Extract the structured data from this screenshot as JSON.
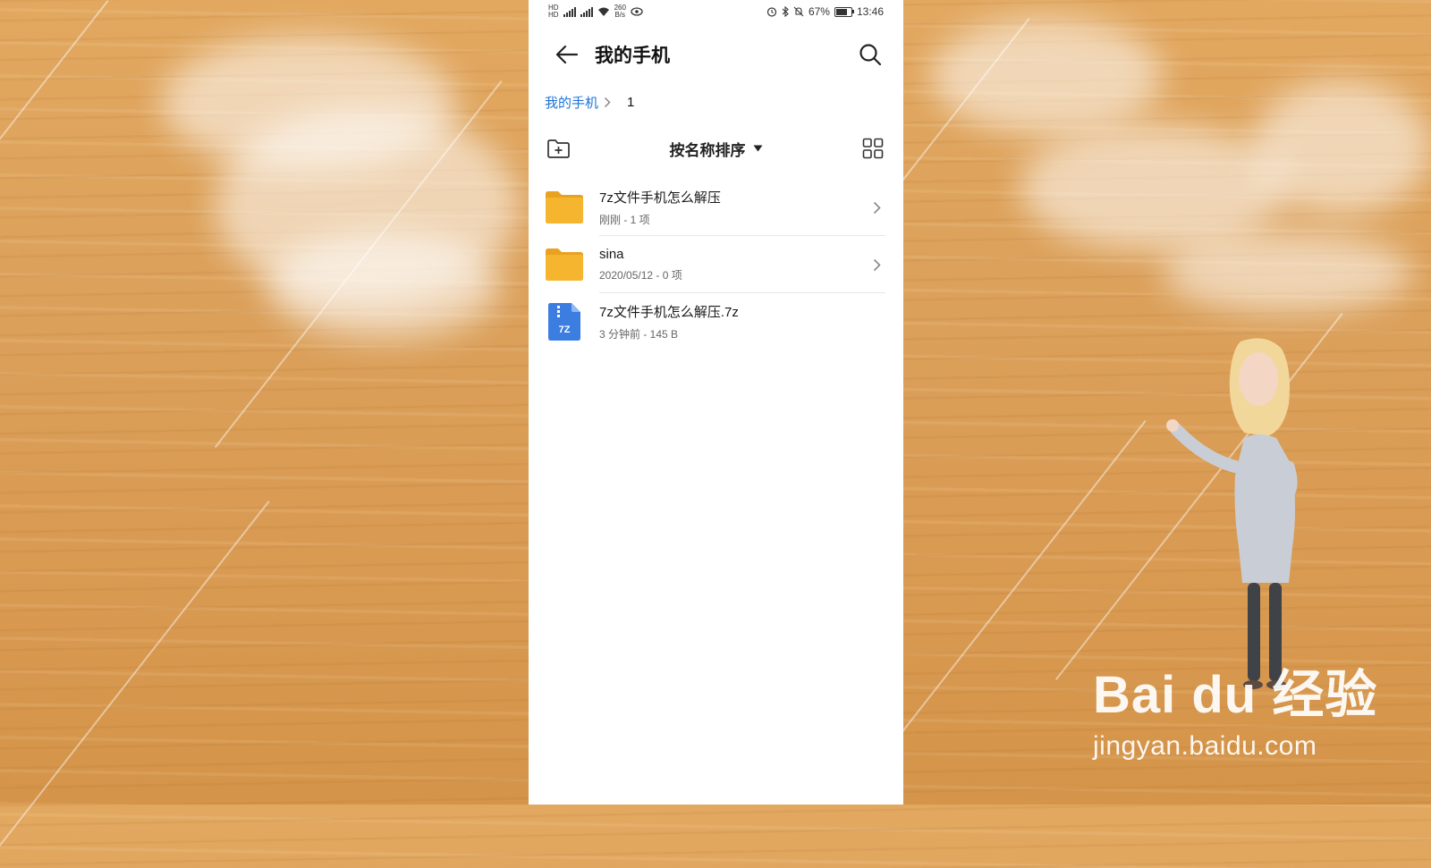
{
  "statusbar": {
    "network_speed": "260",
    "network_unit": "B/s",
    "battery": "67%",
    "time": "13:46"
  },
  "header": {
    "title": "我的手机"
  },
  "breadcrumb": {
    "root": "我的手机",
    "current": "1"
  },
  "toolbar": {
    "sort_label": "按名称排序"
  },
  "files": [
    {
      "name": "7z文件手机怎么解压",
      "meta": "刚刚 - 1 项",
      "type": "folder",
      "icon": "folder-icon"
    },
    {
      "name": "sina",
      "meta": "2020/05/12 - 0 项",
      "type": "folder",
      "icon": "folder-icon"
    },
    {
      "name": "7z文件手机怎么解压.7z",
      "meta": "3 分钟前 - 145 B",
      "type": "archive",
      "icon": "7z-file-icon",
      "badge": "7Z"
    }
  ],
  "watermark": {
    "logo": "Bai du 经验",
    "url": "jingyan.baidu.com"
  },
  "colors": {
    "accent": "#1e74d6",
    "folder": "#f5b52e",
    "archive": "#3b7de0"
  }
}
